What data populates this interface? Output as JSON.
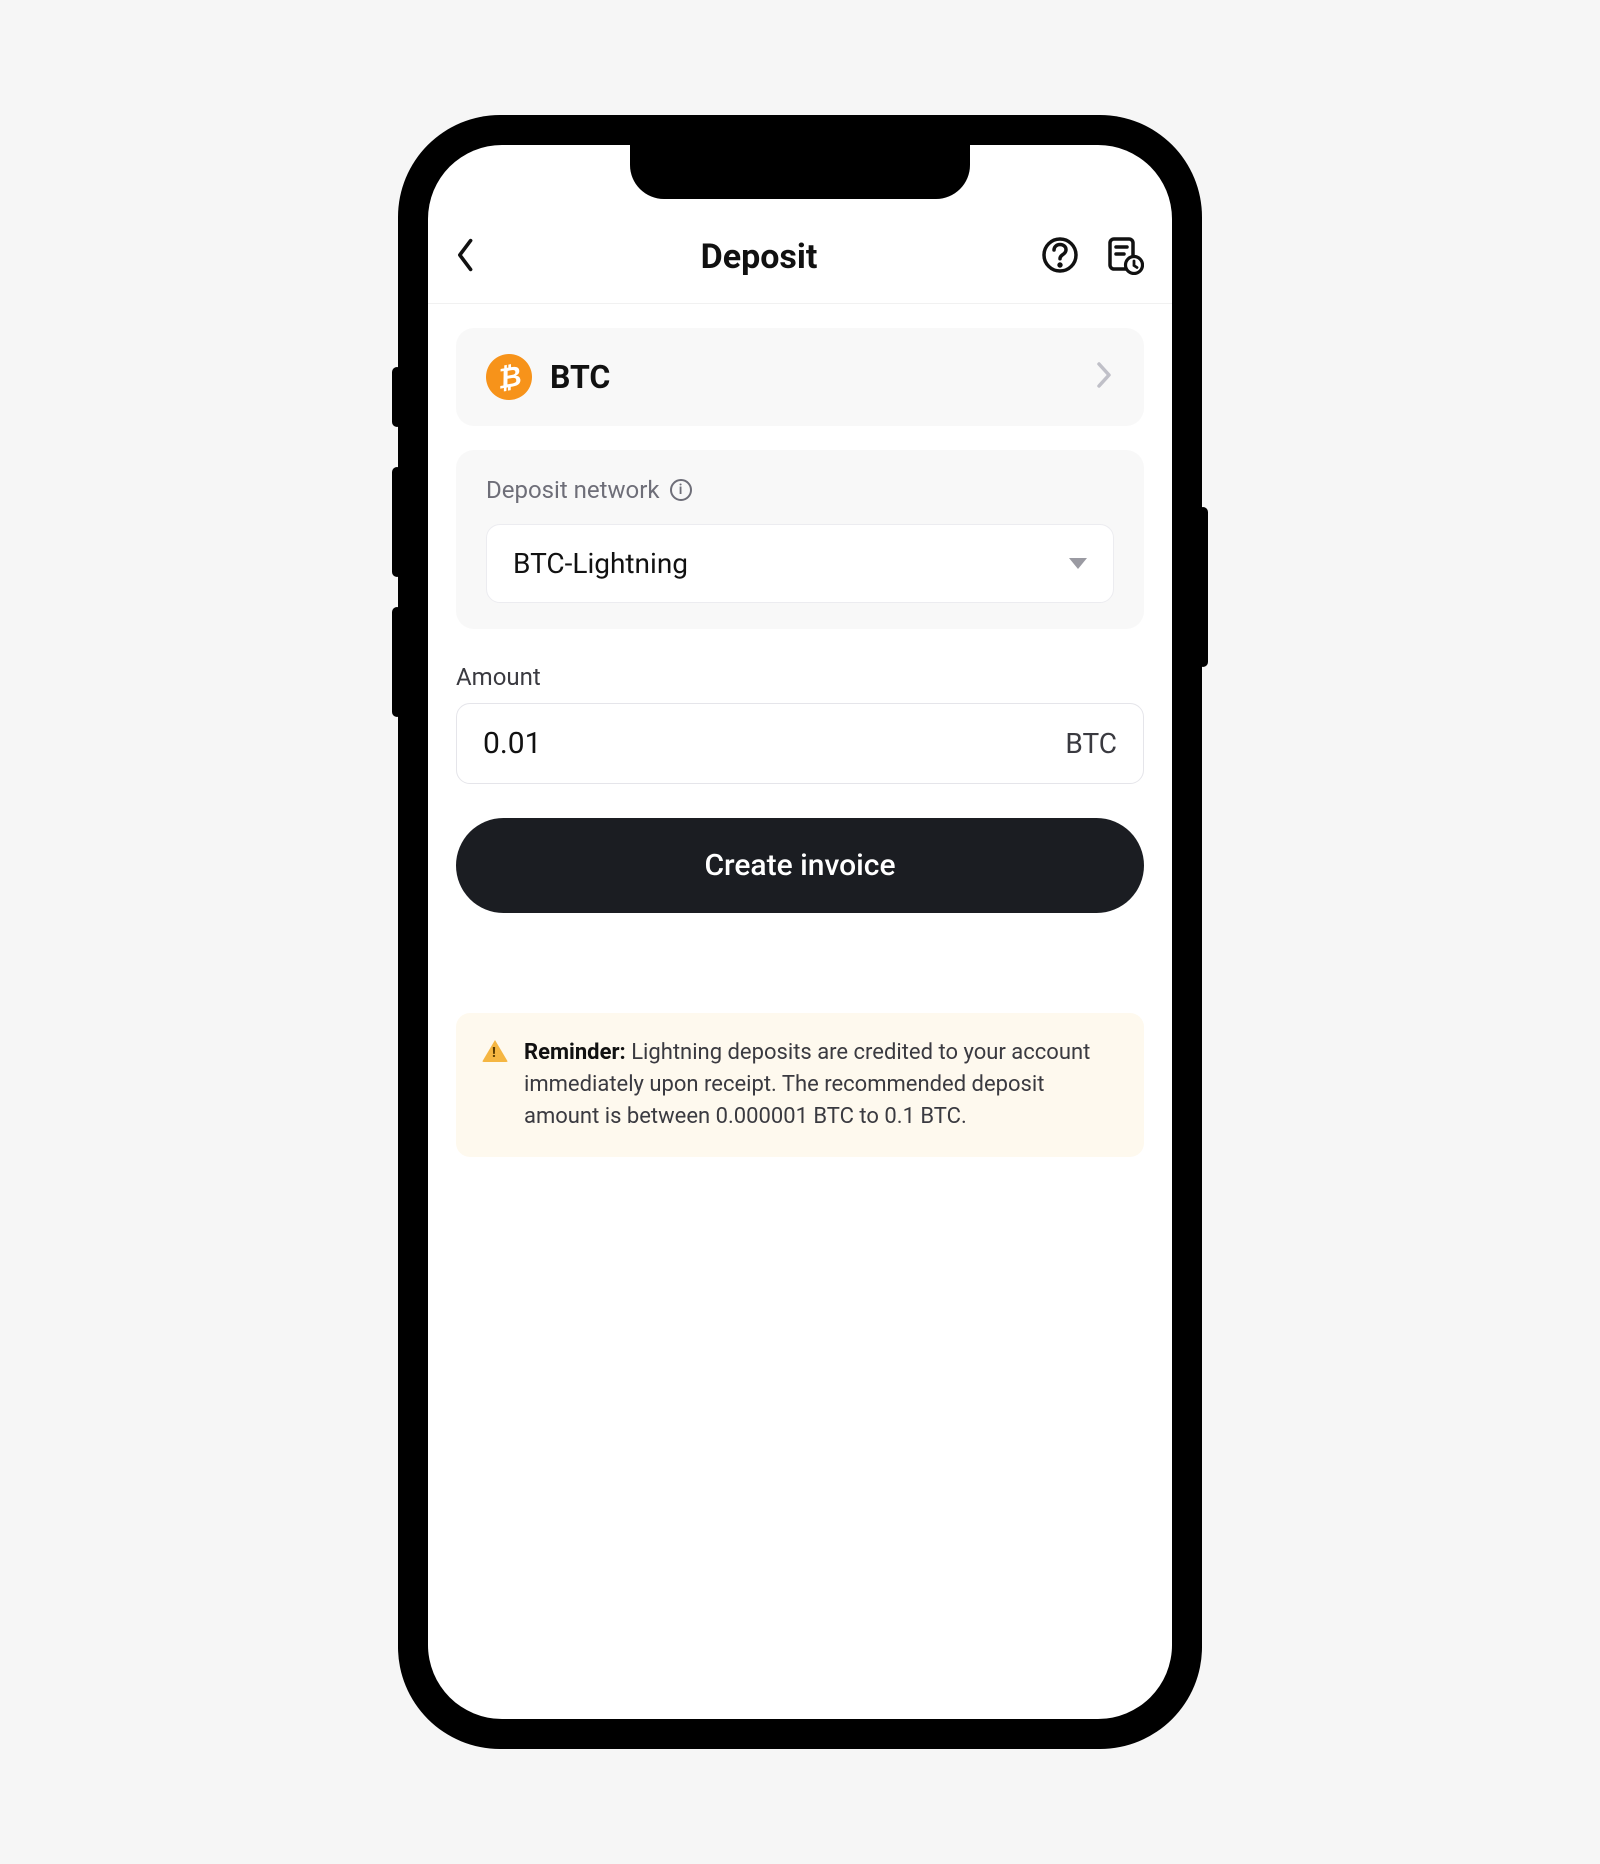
{
  "header": {
    "title": "Deposit"
  },
  "coin": {
    "symbol": "BTC",
    "icon_glyph": "₿"
  },
  "network": {
    "label": "Deposit network",
    "selected": "BTC-Lightning"
  },
  "amount": {
    "label": "Amount",
    "value": "0.01",
    "unit": "BTC"
  },
  "actions": {
    "create_invoice": "Create invoice"
  },
  "reminder": {
    "heading": "Reminder:",
    "body": "Lightning deposits are credited to your account immediately upon receipt. The recommended deposit amount is between 0.000001 BTC to 0.1 BTC."
  },
  "icons": {
    "back": "back-icon",
    "help": "help-icon",
    "history": "history-icon",
    "info": "info-icon",
    "chevron_right": "chevron-right-icon",
    "dropdown": "chevron-down-icon",
    "warning": "warning-icon",
    "bitcoin": "bitcoin-icon"
  }
}
